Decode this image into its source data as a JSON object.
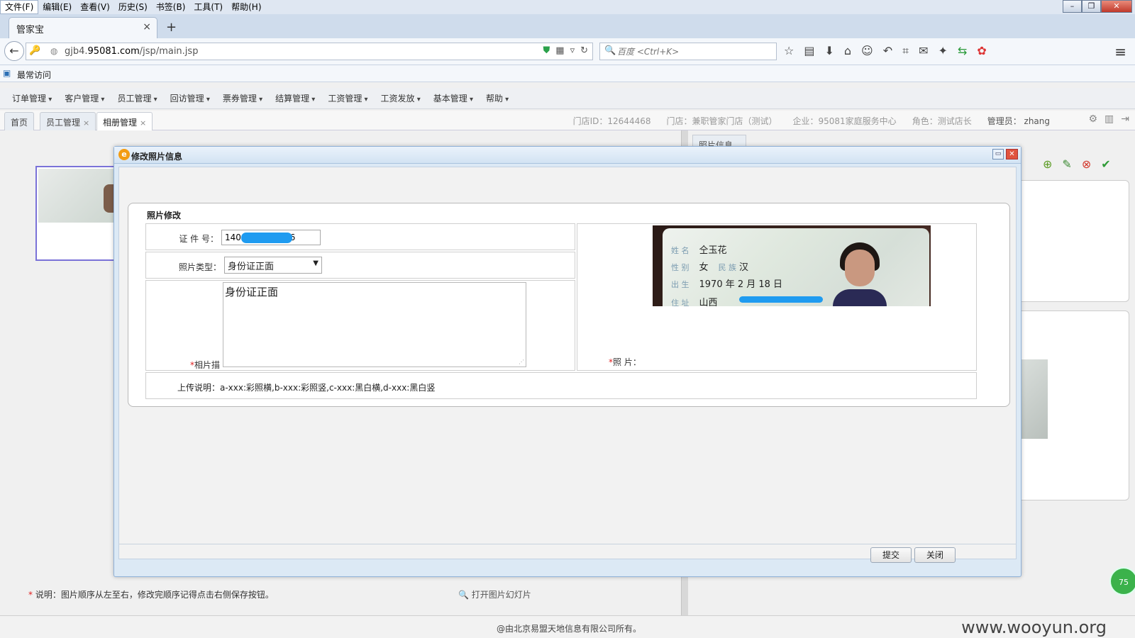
{
  "browser": {
    "menu": [
      "文件(F)",
      "编辑(E)",
      "查看(V)",
      "历史(S)",
      "书签(B)",
      "工具(T)",
      "帮助(H)"
    ],
    "tab_title": "管家宝",
    "tab_close": "×",
    "new_tab": "+",
    "url_prefix": "gjb4.",
    "url_domain": "95081.com",
    "url_path": "/jsp/main.jsp",
    "search_placeholder": "百度 <Ctrl+K>",
    "bookmark_label": "最常访问"
  },
  "app": {
    "menu": [
      "订单管理",
      "客户管理",
      "员工管理",
      "回访管理",
      "票券管理",
      "结算管理",
      "工资管理",
      "工资发放",
      "基本管理",
      "帮助"
    ],
    "tabs": {
      "home": "首页",
      "staff": "员工管理",
      "album": "相册管理"
    },
    "info": {
      "store_id": "门店ID：12644468",
      "store": "门店：兼职管家门店（测试）",
      "company": "企业：95081家庭服务中心",
      "role": "角色：测试店长",
      "admin": "管理员：  zhang"
    },
    "right_panel_tab": "照片信息",
    "bottom_note_prefix": "* ",
    "bottom_note": "说明：图片顺序从左至右，修改完顺序记得点击右侧保存按钮。",
    "slideshow_link": "打开图片幻灯片",
    "copyright": "@由北京易盟天地信息有限公司所有。",
    "watermark": "www.wooyun.org",
    "badge": "75"
  },
  "modal": {
    "title": "修改照片信息",
    "legend": "照片修改",
    "id_label": "证 件 号：",
    "id_value": "1406          2826",
    "type_label": "照片类型：",
    "type_value": "身份证正面",
    "desc_label": "相片描述：",
    "desc_value": "身份证正面",
    "photo_label": "照      片：",
    "upload_note": "上传说明：a-xxx:彩照横,b-xxx:彩照竖,c-xxx:黑白横,d-xxx:黑白竖",
    "submit": "提交",
    "close": "关闭",
    "id_card": {
      "name_label": "姓 名",
      "name": "仝玉花",
      "sex_label": "性 别",
      "sex": "女",
      "nation_label": "民 族",
      "nation": "汉",
      "birth_label": "出 生",
      "birth": "1970  年  2  月 18 日",
      "addr_label": "住 址",
      "addr": "山西"
    }
  },
  "colors": {
    "accent": "#1f9bf0",
    "required": "#e02020",
    "selection_border": "#7a72d8"
  }
}
